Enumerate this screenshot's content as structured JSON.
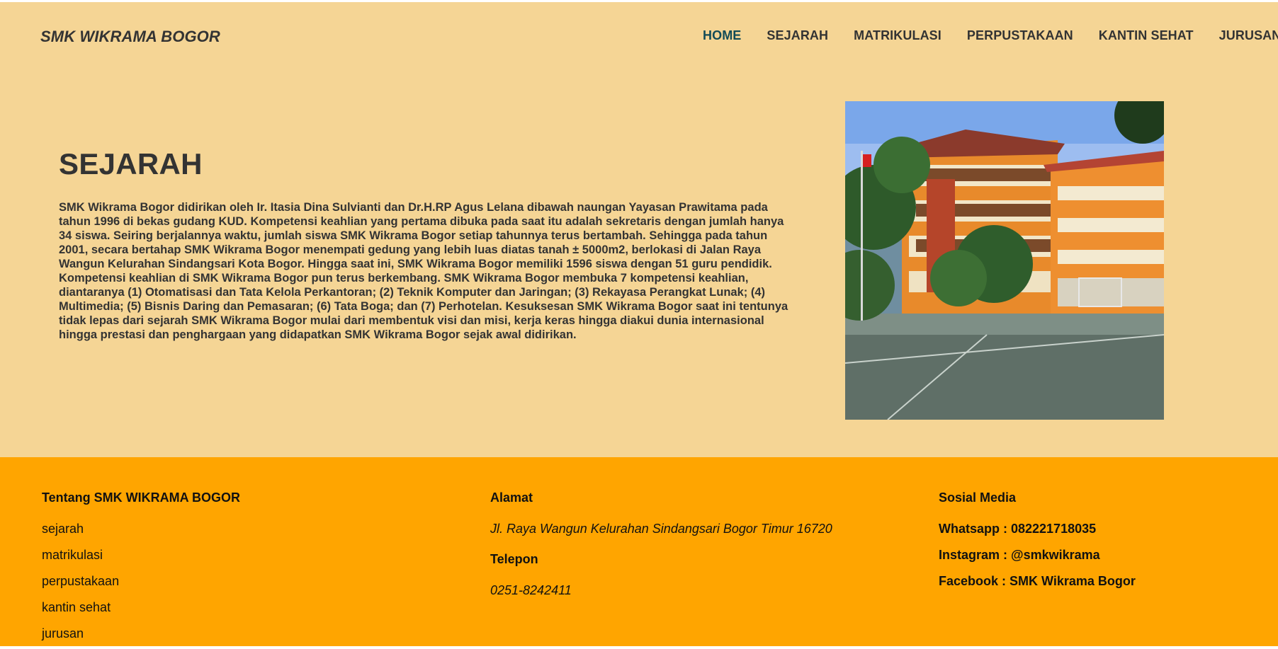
{
  "header": {
    "brand": "SMK WIKRAMA BOGOR",
    "nav": [
      "HOME",
      "SEJARAH",
      "MATRIKULASI",
      "PERPUSTAKAAN",
      "KANTIN SEHAT",
      "JURUSAN"
    ],
    "active": "HOME"
  },
  "hero": {
    "title": "SEJARAH",
    "text": "SMK Wikrama Bogor didirikan oleh Ir. Itasia Dina Sulvianti dan Dr.H.RP Agus Lelana dibawah naungan Yayasan Prawitama pada tahun 1996 di bekas gudang KUD. Kompetensi keahlian yang pertama dibuka pada saat itu adalah sekretaris dengan jumlah hanya 34 siswa. Seiring berjalannya waktu, jumlah siswa SMK Wikrama Bogor setiap tahunnya terus bertambah. Sehingga pada tahun 2001, secara bertahap SMK Wikrama Bogor menempati gedung yang lebih luas diatas tanah ± 5000m2, berlokasi di Jalan Raya Wangun Kelurahan Sindangsari Kota Bogor. Hingga saat ini, SMK Wikrama Bogor memiliki 1596 siswa dengan 51 guru pendidik. Kompetensi keahlian di SMK Wikrama Bogor pun terus berkembang. SMK Wikrama Bogor membuka 7 kompetensi keahlian, diantaranya (1) Otomatisasi dan Tata Kelola Perkantoran; (2) Teknik Komputer dan Jaringan; (3) Rekayasa Perangkat Lunak; (4) Multimedia; (5) Bisnis Daring dan Pemasaran; (6) Tata Boga; dan (7) Perhotelan. Kesuksesan SMK Wikrama Bogor saat ini tentunya tidak lepas dari sejarah SMK Wikrama Bogor mulai dari membentuk visi dan misi, kerja keras hingga diakui dunia internasional hingga prestasi dan penghargaan yang didapatkan SMK Wikrama Bogor sejak awal didirikan."
  },
  "footer": {
    "about": {
      "title": "Tentang SMK WIKRAMA BOGOR",
      "links": [
        "sejarah",
        "matrikulasi",
        "perpustakaan",
        "kantin sehat",
        "jurusan"
      ]
    },
    "address": {
      "title": "Alamat",
      "value": "Jl. Raya Wangun Kelurahan Sindangsari Bogor Timur 16720",
      "phone_title": "Telepon",
      "phone": "0251-8242411"
    },
    "social": {
      "title": "Sosial Media",
      "items": [
        "Whatsapp : 082221718035",
        "Instagram : @smkwikrama",
        "Facebook : SMK Wikrama Bogor"
      ]
    }
  },
  "colors": {
    "header_bg": "#f5d595",
    "footer_bg": "#ffa500",
    "active_nav": "#124b57",
    "text": "#333333"
  }
}
